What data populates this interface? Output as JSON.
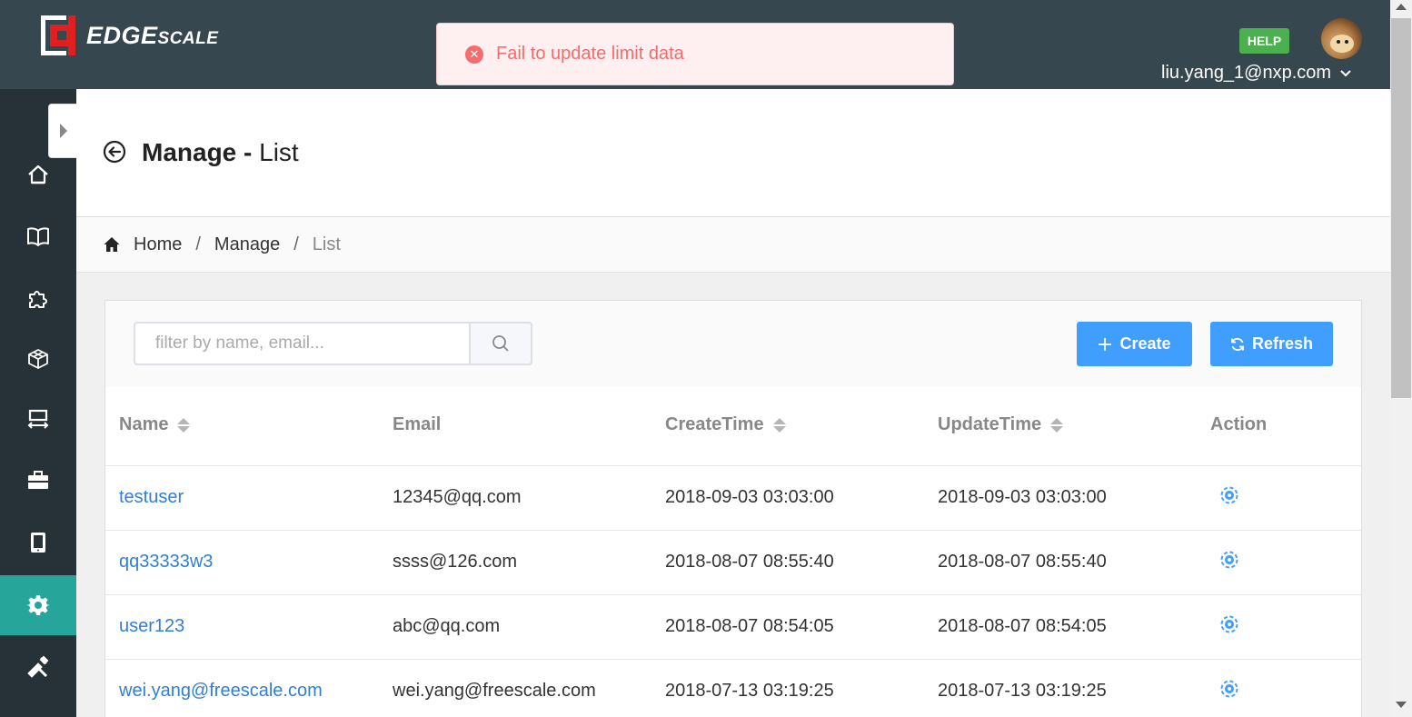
{
  "header": {
    "logo_main": "EDGE",
    "logo_small": "SCALE",
    "help_label": "HELP",
    "user_email": "liu.yang_1@nxp.com",
    "user_menu_icon": "chevron-down-icon"
  },
  "toast": {
    "type": "error",
    "icon": "close-circle-icon",
    "message": "Fail to update limit data"
  },
  "sidebar": {
    "items": [
      {
        "icon": "home-icon"
      },
      {
        "icon": "book-icon"
      },
      {
        "icon": "puzzle-icon"
      },
      {
        "icon": "cube-icon"
      },
      {
        "icon": "transfer-icon"
      },
      {
        "icon": "briefcase-icon"
      },
      {
        "icon": "tablet-icon"
      },
      {
        "icon": "gear-icon",
        "active": true
      },
      {
        "icon": "tools-icon"
      }
    ],
    "active_color": "#26a69a"
  },
  "page": {
    "title_bold": "Manage",
    "title_sep": " - ",
    "title_rest": "List"
  },
  "breadcrumb": {
    "items": [
      "Home",
      "Manage",
      "List"
    ],
    "separator": "/"
  },
  "toolbar": {
    "search_placeholder": "filter by name, email...",
    "create_label": "Create",
    "refresh_label": "Refresh"
  },
  "table": {
    "columns": [
      "Name",
      "Email",
      "CreateTime",
      "UpdateTime",
      "Action"
    ],
    "rows": [
      {
        "name": "testuser",
        "email": "12345@qq.com",
        "create": "2018-09-03 03:03:00",
        "update": "2018-09-03 03:03:00"
      },
      {
        "name": "qq33333w3",
        "email": "ssss@126.com",
        "create": "2018-08-07 08:55:40",
        "update": "2018-08-07 08:55:40"
      },
      {
        "name": "user123",
        "email": "abc@qq.com",
        "create": "2018-08-07 08:54:05",
        "update": "2018-08-07 08:54:05"
      },
      {
        "name": "wei.yang@freescale.com",
        "email": "wei.yang@freescale.com",
        "create": "2018-07-13 03:19:25",
        "update": "2018-07-13 03:19:25"
      }
    ]
  },
  "colors": {
    "header_bg": "#37474f",
    "sidebar_bg": "#263238",
    "primary": "#409eff",
    "link": "#2f7fd6",
    "help_green": "#4caf50",
    "error": "#f56c6c"
  }
}
